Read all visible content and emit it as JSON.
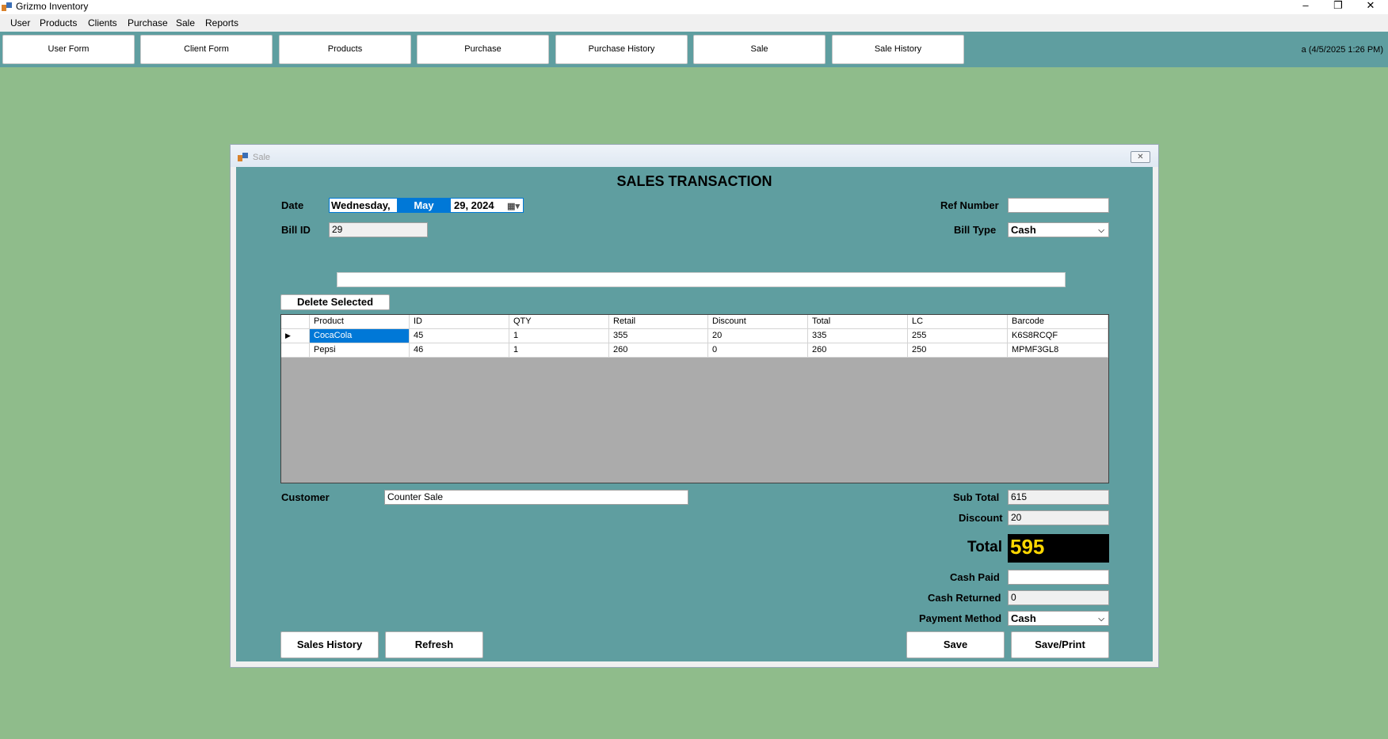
{
  "window": {
    "title": "Grizmo Inventory",
    "controls": [
      "–",
      "❐",
      "✕"
    ]
  },
  "menu": [
    "User",
    "Products",
    "Clients",
    "Purchase",
    "Sale",
    "Reports"
  ],
  "toolbar": {
    "buttons": [
      "User Form",
      "Client Form",
      "Products",
      "Purchase",
      "Purchase History",
      "Sale",
      "Sale History"
    ],
    "status": "a (4/5/2025 1:26 PM)"
  },
  "dialog": {
    "title": "Sale",
    "heading": "SALES TRANSACTION",
    "date": {
      "label": "Date",
      "weekday": "Wednesday,",
      "month": "May",
      "dayyear": "29, 2024"
    },
    "bill_id": {
      "label": "Bill ID",
      "value": "29"
    },
    "ref_number": {
      "label": "Ref Number",
      "value": ""
    },
    "bill_type": {
      "label": "Bill Type",
      "value": "Cash"
    },
    "search": {
      "value": ""
    },
    "delete_selected": "Delete Selected",
    "grid": {
      "columns": [
        "Product",
        "ID",
        "QTY",
        "Retail",
        "Discount",
        "Total",
        "LC",
        "Barcode"
      ],
      "rows": [
        [
          "CocaCola",
          "45",
          "1",
          "355",
          "20",
          "335",
          "255",
          "K6S8RCQF"
        ],
        [
          "Pepsi",
          "46",
          "1",
          "260",
          "0",
          "260",
          "250",
          "MPMF3GL8"
        ]
      ],
      "current_row_marker": "▶"
    },
    "customer": {
      "label": "Customer",
      "value": "Counter Sale"
    },
    "sub_total": {
      "label": "Sub Total",
      "value": "615"
    },
    "discount": {
      "label": "Discount",
      "value": "20"
    },
    "total": {
      "label": "Total",
      "value": "595"
    },
    "cash_paid": {
      "label": "Cash Paid",
      "value": ""
    },
    "cash_returned": {
      "label": "Cash Returned",
      "value": "0"
    },
    "payment_method": {
      "label": "Payment Method",
      "value": "Cash"
    },
    "buttons": {
      "sales_history": "Sales History",
      "refresh": "Refresh",
      "save": "Save",
      "save_print": "Save/Print"
    },
    "close_glyph": "✕",
    "combo_glyph": "⌵",
    "calendar_glyph": "▦▾"
  },
  "colors": {
    "desktop": "#8fbc8b",
    "toolbar": "#5f9ea0",
    "selection": "#0078d7",
    "total_text": "#ffd700"
  }
}
